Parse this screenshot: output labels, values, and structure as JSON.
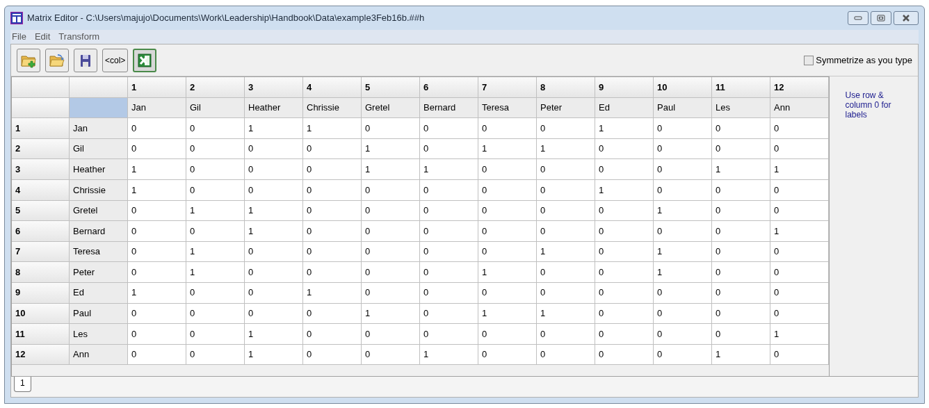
{
  "window": {
    "title": "Matrix Editor - C:\\Users\\majujo\\Documents\\Work\\Leadership\\Handbook\\Data\\example3Feb16b.##h"
  },
  "menu": [
    "File",
    "Edit",
    "Transform"
  ],
  "toolbar": [
    {
      "kind": "new-folder",
      "pressed": false
    },
    {
      "kind": "open-folder",
      "pressed": false
    },
    {
      "kind": "save",
      "pressed": false
    },
    {
      "kind": "text",
      "label": "<col>",
      "pressed": false
    },
    {
      "kind": "spreadsheet",
      "pressed": true
    }
  ],
  "symmetrize": {
    "label": "Symmetrize as you type",
    "checked": false
  },
  "table": {
    "column_numbers": [
      "1",
      "2",
      "3",
      "4",
      "5",
      "6",
      "7",
      "8",
      "9",
      "10",
      "11",
      "12"
    ],
    "column_labels": [
      "Jan",
      "Gil",
      "Heather",
      "Chrissie",
      "Gretel",
      "Bernard",
      "Teresa",
      "Peter",
      "Ed",
      "Paul",
      "Les",
      "Ann"
    ],
    "label_corner": {
      "selected": true
    },
    "rows": [
      {
        "number": "1",
        "label": "Jan",
        "values": [
          "0",
          "0",
          "1",
          "1",
          "0",
          "0",
          "0",
          "0",
          "1",
          "0",
          "0",
          "0"
        ]
      },
      {
        "number": "2",
        "label": "Gil",
        "values": [
          "0",
          "0",
          "0",
          "0",
          "1",
          "0",
          "1",
          "1",
          "0",
          "0",
          "0",
          "0"
        ]
      },
      {
        "number": "3",
        "label": "Heather",
        "values": [
          "1",
          "0",
          "0",
          "0",
          "1",
          "1",
          "0",
          "0",
          "0",
          "0",
          "1",
          "1"
        ]
      },
      {
        "number": "4",
        "label": "Chrissie",
        "values": [
          "1",
          "0",
          "0",
          "0",
          "0",
          "0",
          "0",
          "0",
          "1",
          "0",
          "0",
          "0"
        ]
      },
      {
        "number": "5",
        "label": "Gretel",
        "values": [
          "0",
          "1",
          "1",
          "0",
          "0",
          "0",
          "0",
          "0",
          "0",
          "1",
          "0",
          "0"
        ]
      },
      {
        "number": "6",
        "label": "Bernard",
        "values": [
          "0",
          "0",
          "1",
          "0",
          "0",
          "0",
          "0",
          "0",
          "0",
          "0",
          "0",
          "1"
        ]
      },
      {
        "number": "7",
        "label": "Teresa",
        "values": [
          "0",
          "1",
          "0",
          "0",
          "0",
          "0",
          "0",
          "1",
          "0",
          "1",
          "0",
          "0"
        ]
      },
      {
        "number": "8",
        "label": "Peter",
        "values": [
          "0",
          "1",
          "0",
          "0",
          "0",
          "0",
          "1",
          "0",
          "0",
          "1",
          "0",
          "0"
        ]
      },
      {
        "number": "9",
        "label": "Ed",
        "values": [
          "1",
          "0",
          "0",
          "1",
          "0",
          "0",
          "0",
          "0",
          "0",
          "0",
          "0",
          "0"
        ]
      },
      {
        "number": "10",
        "label": "Paul",
        "values": [
          "0",
          "0",
          "0",
          "0",
          "1",
          "0",
          "1",
          "1",
          "0",
          "0",
          "0",
          "0"
        ]
      },
      {
        "number": "11",
        "label": "Les",
        "values": [
          "0",
          "0",
          "1",
          "0",
          "0",
          "0",
          "0",
          "0",
          "0",
          "0",
          "0",
          "1"
        ]
      },
      {
        "number": "12",
        "label": "Ann",
        "values": [
          "0",
          "0",
          "1",
          "0",
          "0",
          "1",
          "0",
          "0",
          "0",
          "0",
          "1",
          "0"
        ]
      }
    ]
  },
  "side_note": "Use row & column 0 for labels",
  "sheet_tabs": [
    {
      "label": "1",
      "selected": true
    }
  ]
}
